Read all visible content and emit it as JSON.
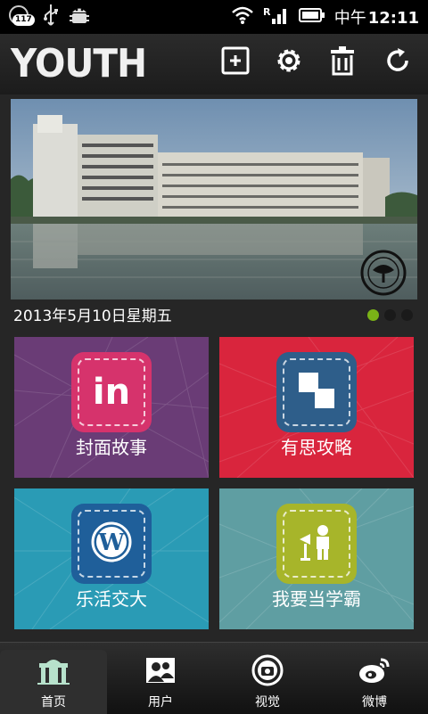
{
  "status_bar": {
    "notification_count": "117",
    "time_prefix": "中午",
    "time": "12:11"
  },
  "header": {
    "logo": "YOUTH",
    "actions": [
      "add-icon",
      "gear-icon",
      "trash-icon",
      "refresh-icon"
    ]
  },
  "banner": {
    "date": "2013年5月10日星期五",
    "slide_count": 3,
    "active_slide": 1
  },
  "tiles": [
    {
      "label": "封面故事",
      "color": "#6a3c76",
      "icon": "linkedin-in-icon",
      "icon_color": "#d6336c"
    },
    {
      "label": "有思攻略",
      "color": "#d9253d",
      "icon": "squares-icon",
      "icon_color": "#2e5e8a"
    },
    {
      "label": "乐活交大",
      "color": "#2a9bb5",
      "icon": "wordpress-icon",
      "icon_color": "#1f5f9a"
    },
    {
      "label": "我要当学霸",
      "color": "#5f9ea2",
      "icon": "scholar-icon",
      "icon_color": "#a7b52a"
    }
  ],
  "tabs": [
    {
      "label": "首页",
      "icon": "home-gate-icon",
      "active": true
    },
    {
      "label": "用户",
      "icon": "users-icon",
      "active": false
    },
    {
      "label": "视觉",
      "icon": "camera-icon",
      "active": false
    },
    {
      "label": "微博",
      "icon": "weibo-icon",
      "active": false
    }
  ]
}
